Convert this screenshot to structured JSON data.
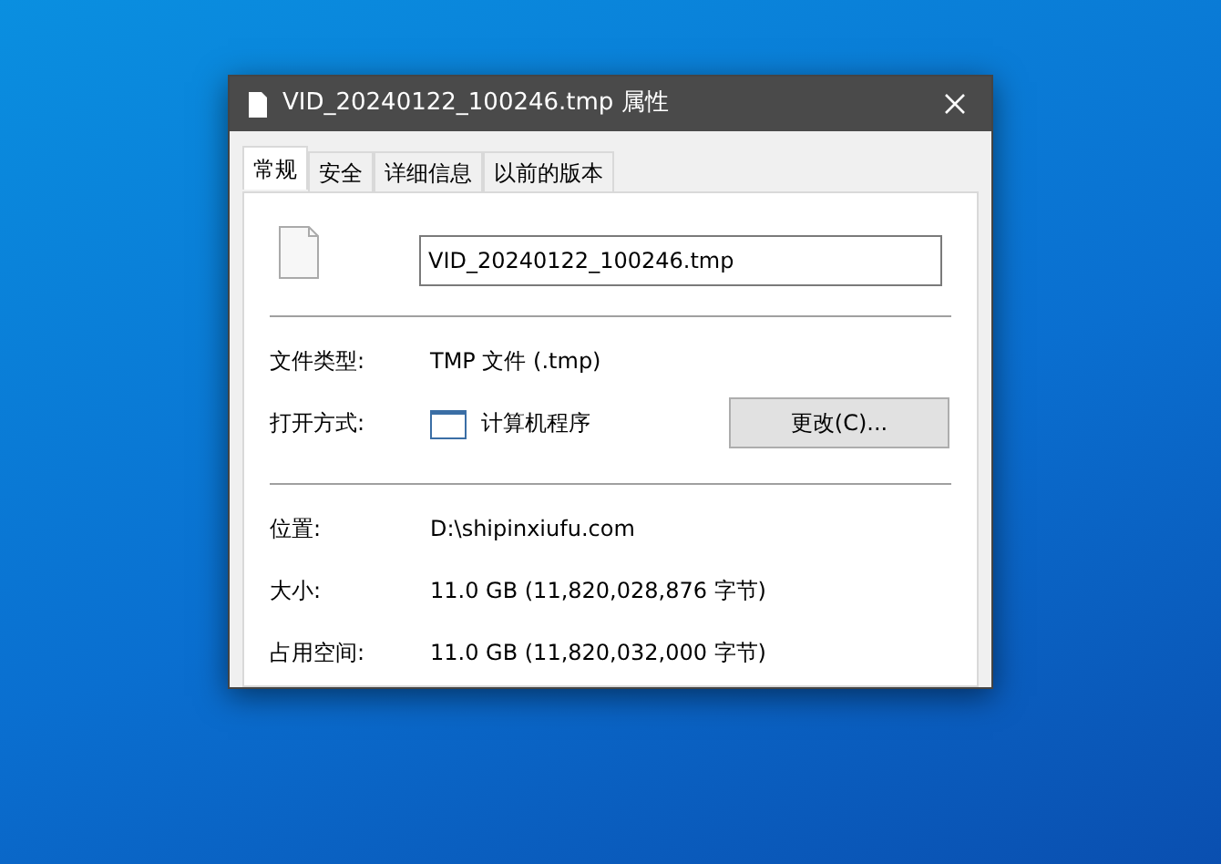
{
  "window": {
    "title": "VID_20240122_100246.tmp 属性"
  },
  "tabs": [
    {
      "label": "常规",
      "selected": true
    },
    {
      "label": "安全",
      "selected": false
    },
    {
      "label": "详细信息",
      "selected": false
    },
    {
      "label": "以前的版本",
      "selected": false
    }
  ],
  "file_name": {
    "value": "VID_20240122_100246.tmp"
  },
  "groups": [
    [
      {
        "kind": "text",
        "label": "文件类型:",
        "value": "TMP 文件 (.tmp)"
      },
      {
        "kind": "app",
        "label": "打开方式:",
        "value": "计算机程序",
        "button": "更改(C)..."
      }
    ],
    [
      {
        "kind": "text",
        "label": "位置:",
        "value": "D:\\shipinxiufu.com"
      },
      {
        "kind": "text",
        "label": "大小:",
        "value": "11.0 GB (11,820,028,876 字节)"
      },
      {
        "kind": "text",
        "label": "占用空间:",
        "value": "11.0 GB (11,820,032,000 字节)"
      }
    ]
  ]
}
